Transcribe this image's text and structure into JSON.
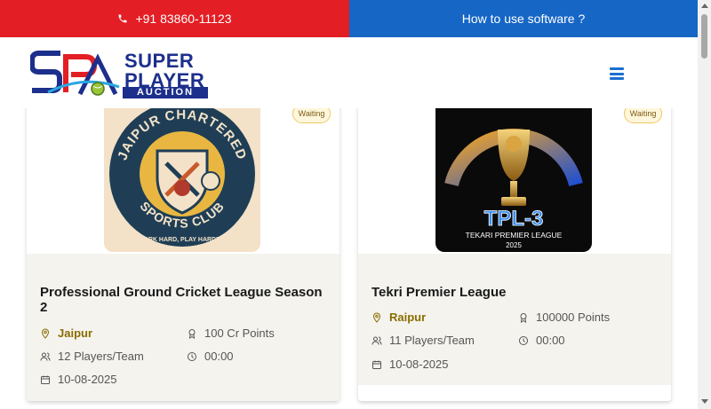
{
  "topbar": {
    "phone": "+91 83860-11123",
    "help": "How to use software ?"
  },
  "header": {
    "logo_monogram": "SPA",
    "logo_line1": "SUPER",
    "logo_line2": "PLAYER",
    "logo_line3": "AUCTION"
  },
  "cards": [
    {
      "badge": "Waiting",
      "logo_top": "JAIPUR CHARTERED",
      "logo_mid": "SPORTS CLUB",
      "logo_bottom": "WORK HARD, PLAY HARDER!",
      "title": "Professional Ground Cricket League Season 2",
      "city": "Jaipur",
      "points": "100 Cr Points",
      "players": "12 Players/Team",
      "time": "00:00",
      "date": "10-08-2025"
    },
    {
      "badge": "Waiting",
      "logo_big": "TPL-3",
      "logo_sub": "TEKARI PREMIER LEAGUE",
      "logo_year": "2025",
      "title": "Tekri Premier League",
      "city": "Raipur",
      "points": "100000 Points",
      "players": "11 Players/Team",
      "time": "00:00",
      "date": "10-08-2025"
    }
  ],
  "colors": {
    "phone_bar": "#e31e24",
    "help_bar": "#1666c6",
    "brand_navy": "#1c2f8c",
    "city_text": "#8a6d00",
    "card_bg": "#f4f3ee"
  },
  "icons": [
    "phone-icon",
    "menu-icon",
    "location-pin-icon",
    "award-icon",
    "users-icon",
    "clock-icon",
    "calendar-icon"
  ]
}
